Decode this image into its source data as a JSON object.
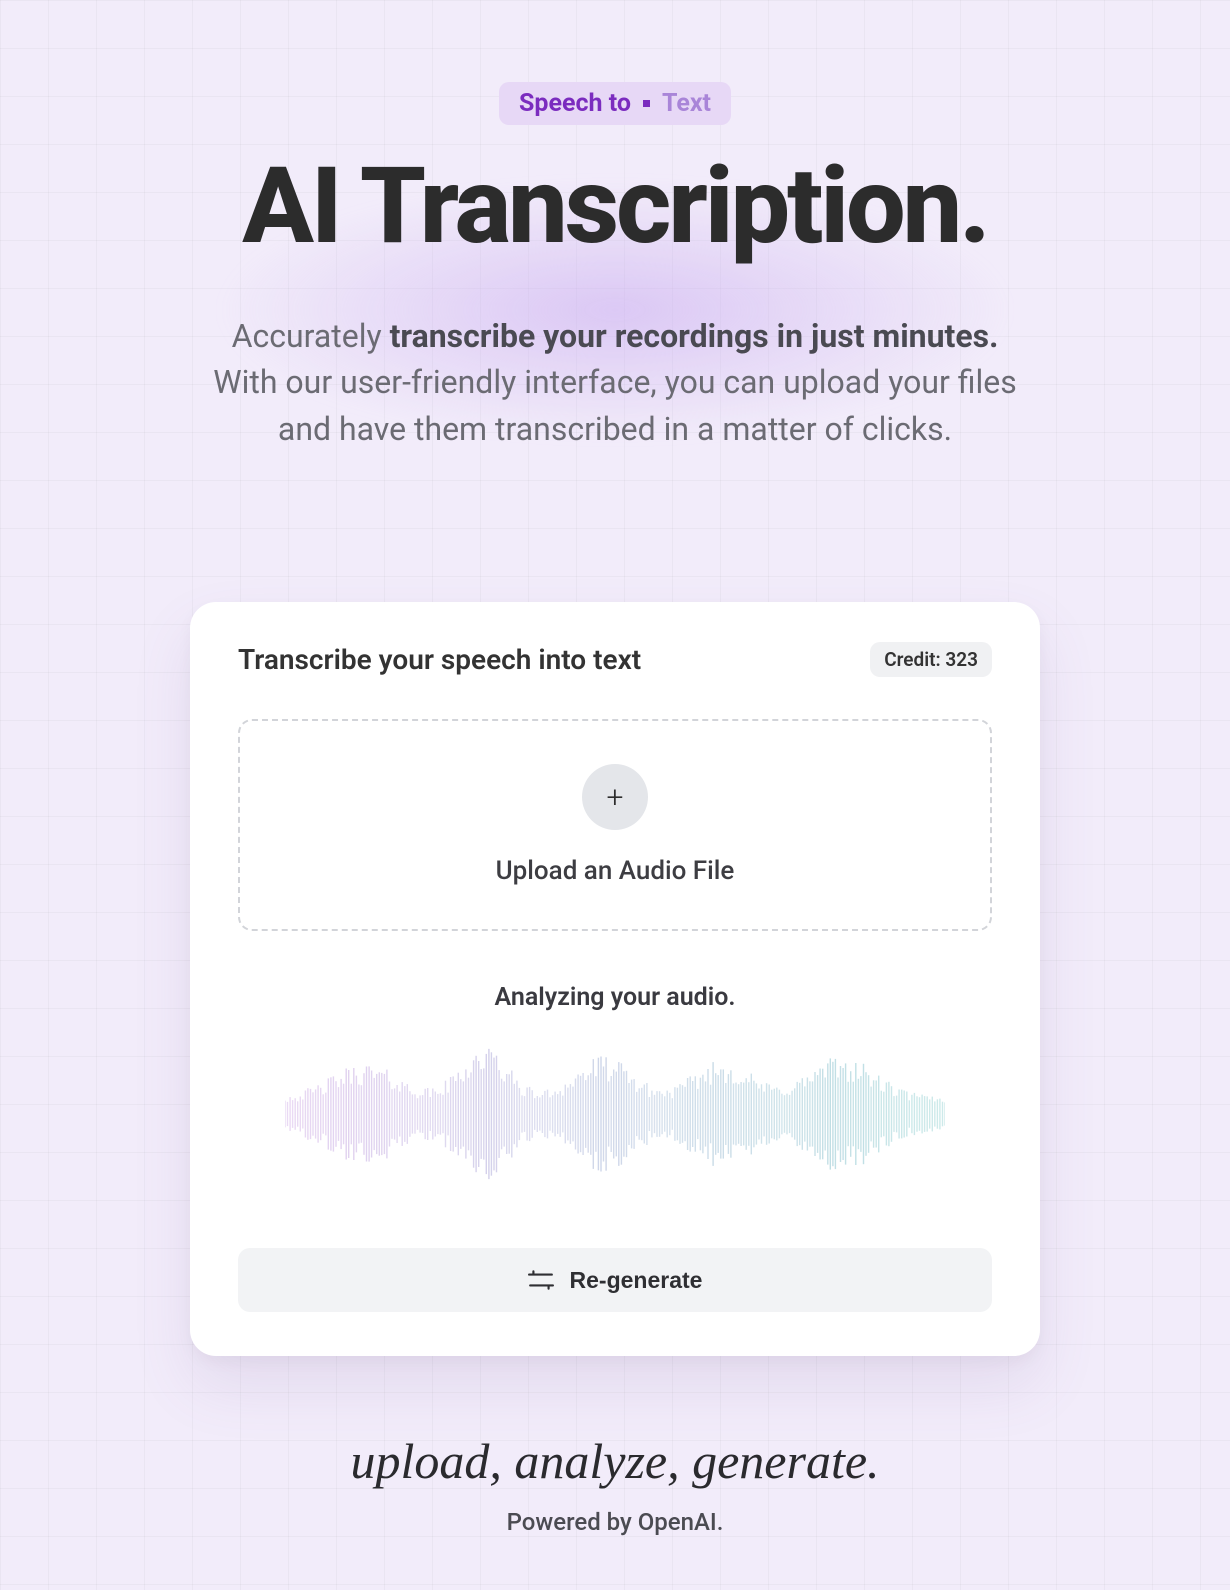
{
  "badge": {
    "left": "Speech to",
    "right": "Text"
  },
  "hero": {
    "title": "AI Transcription.",
    "subtitle_pre": "Accurately ",
    "subtitle_bold": "transcribe your recordings in just minutes.",
    "subtitle_post": " With our user-friendly interface, you can upload your files and have them transcribed in a matter of clicks."
  },
  "card": {
    "title": "Transcribe your speech into text",
    "credit_label": "Credit: 323",
    "upload_label": "Upload an Audio File",
    "status": "Analyzing your audio.",
    "regenerate_label": "Re-generate"
  },
  "footer": {
    "script": "upload, analyze, generate.",
    "powered": "Powered by OpenAI."
  }
}
